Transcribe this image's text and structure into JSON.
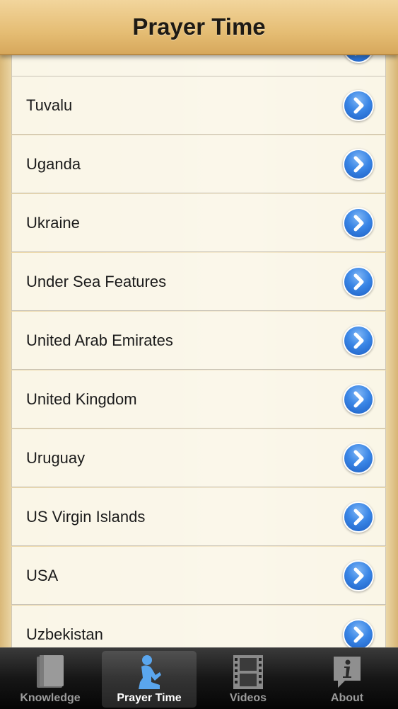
{
  "header": {
    "title": "Prayer Time"
  },
  "countries": [
    "Tuvalu",
    "Uganda",
    "Ukraine",
    "Under Sea Features",
    "United Arab Emirates",
    "United Kingdom",
    "Uruguay",
    "US Virgin Islands",
    "USA",
    "Uzbekistan"
  ],
  "tabs": [
    {
      "label": "Knowledge",
      "icon": "book-icon",
      "active": false
    },
    {
      "label": "Prayer Time",
      "icon": "praying-person-icon",
      "active": true
    },
    {
      "label": "Videos",
      "icon": "film-icon",
      "active": false
    },
    {
      "label": "About",
      "icon": "info-icon",
      "active": false
    }
  ],
  "colors": {
    "accent": "#2f7ee2",
    "header": "#e5bd74",
    "tabbar": "#161616"
  }
}
